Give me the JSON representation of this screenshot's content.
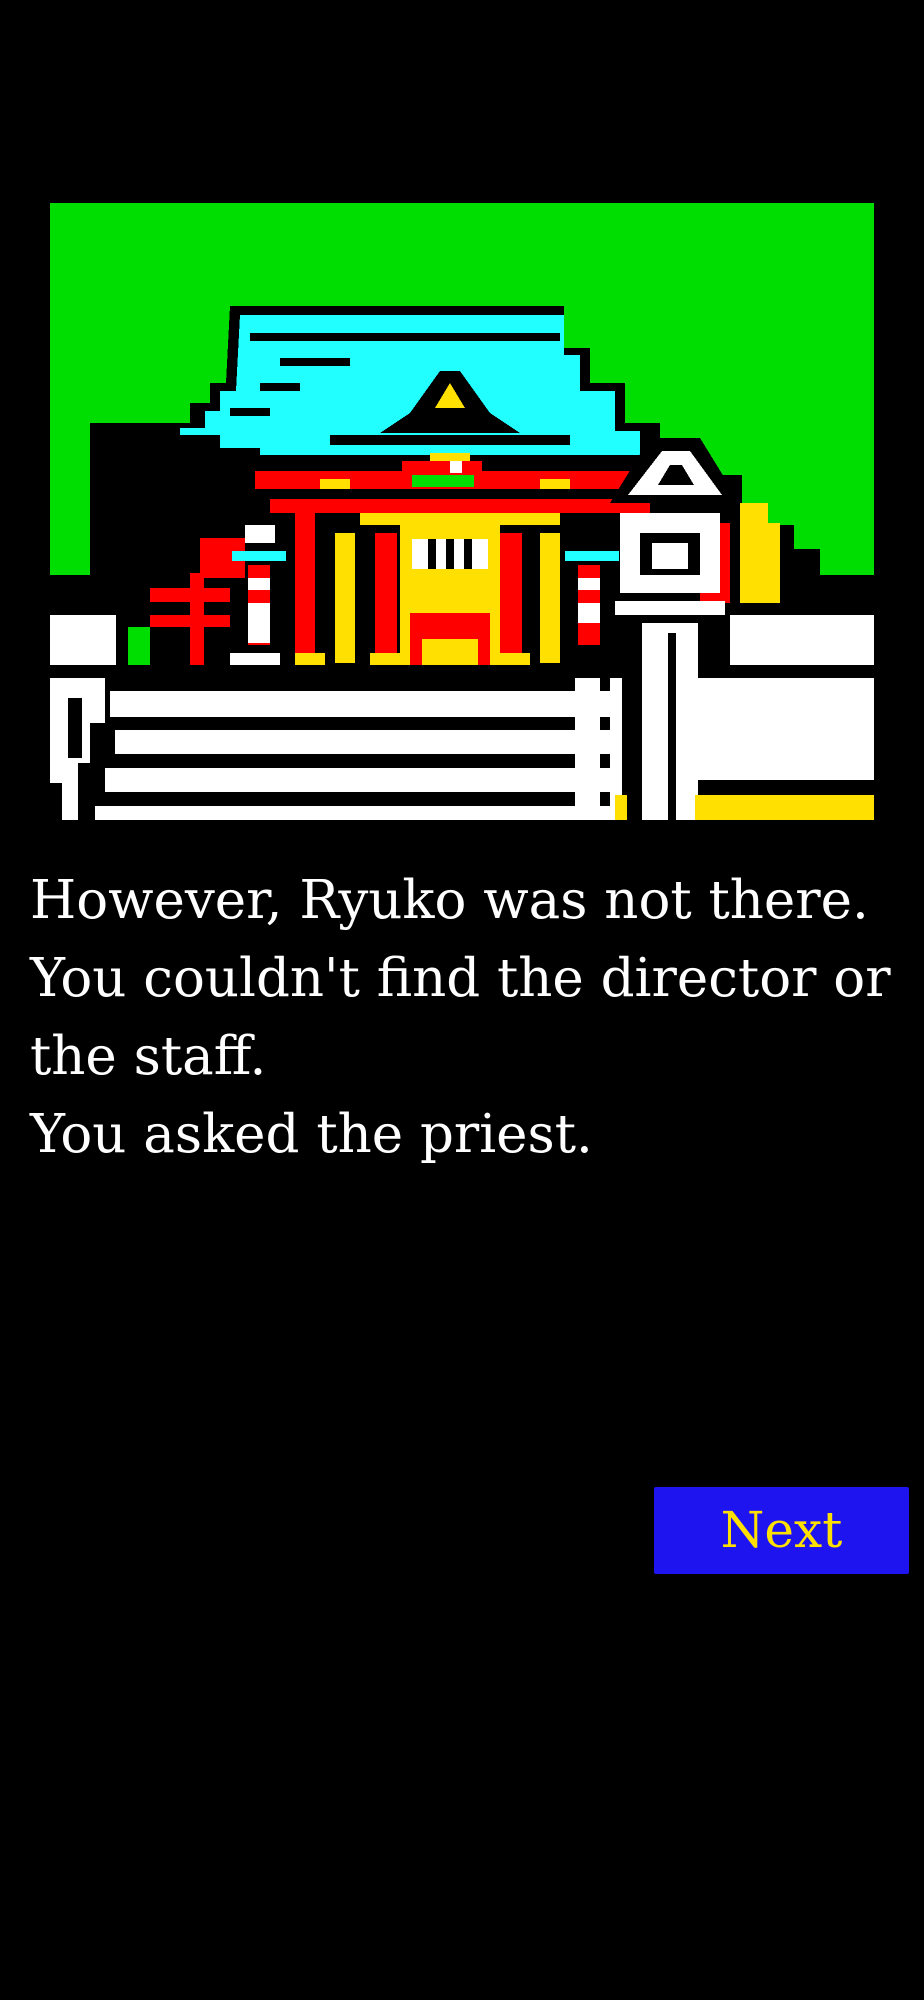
{
  "scene": {
    "name": "shrine-pixel-art",
    "colors": {
      "sky": "#00dd00",
      "roof": "#22ffff",
      "red": "#ff0000",
      "yellow": "#ffe000",
      "white": "#ffffff",
      "black": "#000000"
    }
  },
  "story": {
    "lines": [
      "However, Ryuko was not there.",
      "You couldn't find the director or",
      "the staff.",
      "You asked the priest."
    ]
  },
  "controls": {
    "next_label": "Next"
  },
  "theme": {
    "background": "#000000",
    "text": "#ffffff",
    "button_bg": "#1e14f0",
    "button_text": "#ffe000"
  }
}
